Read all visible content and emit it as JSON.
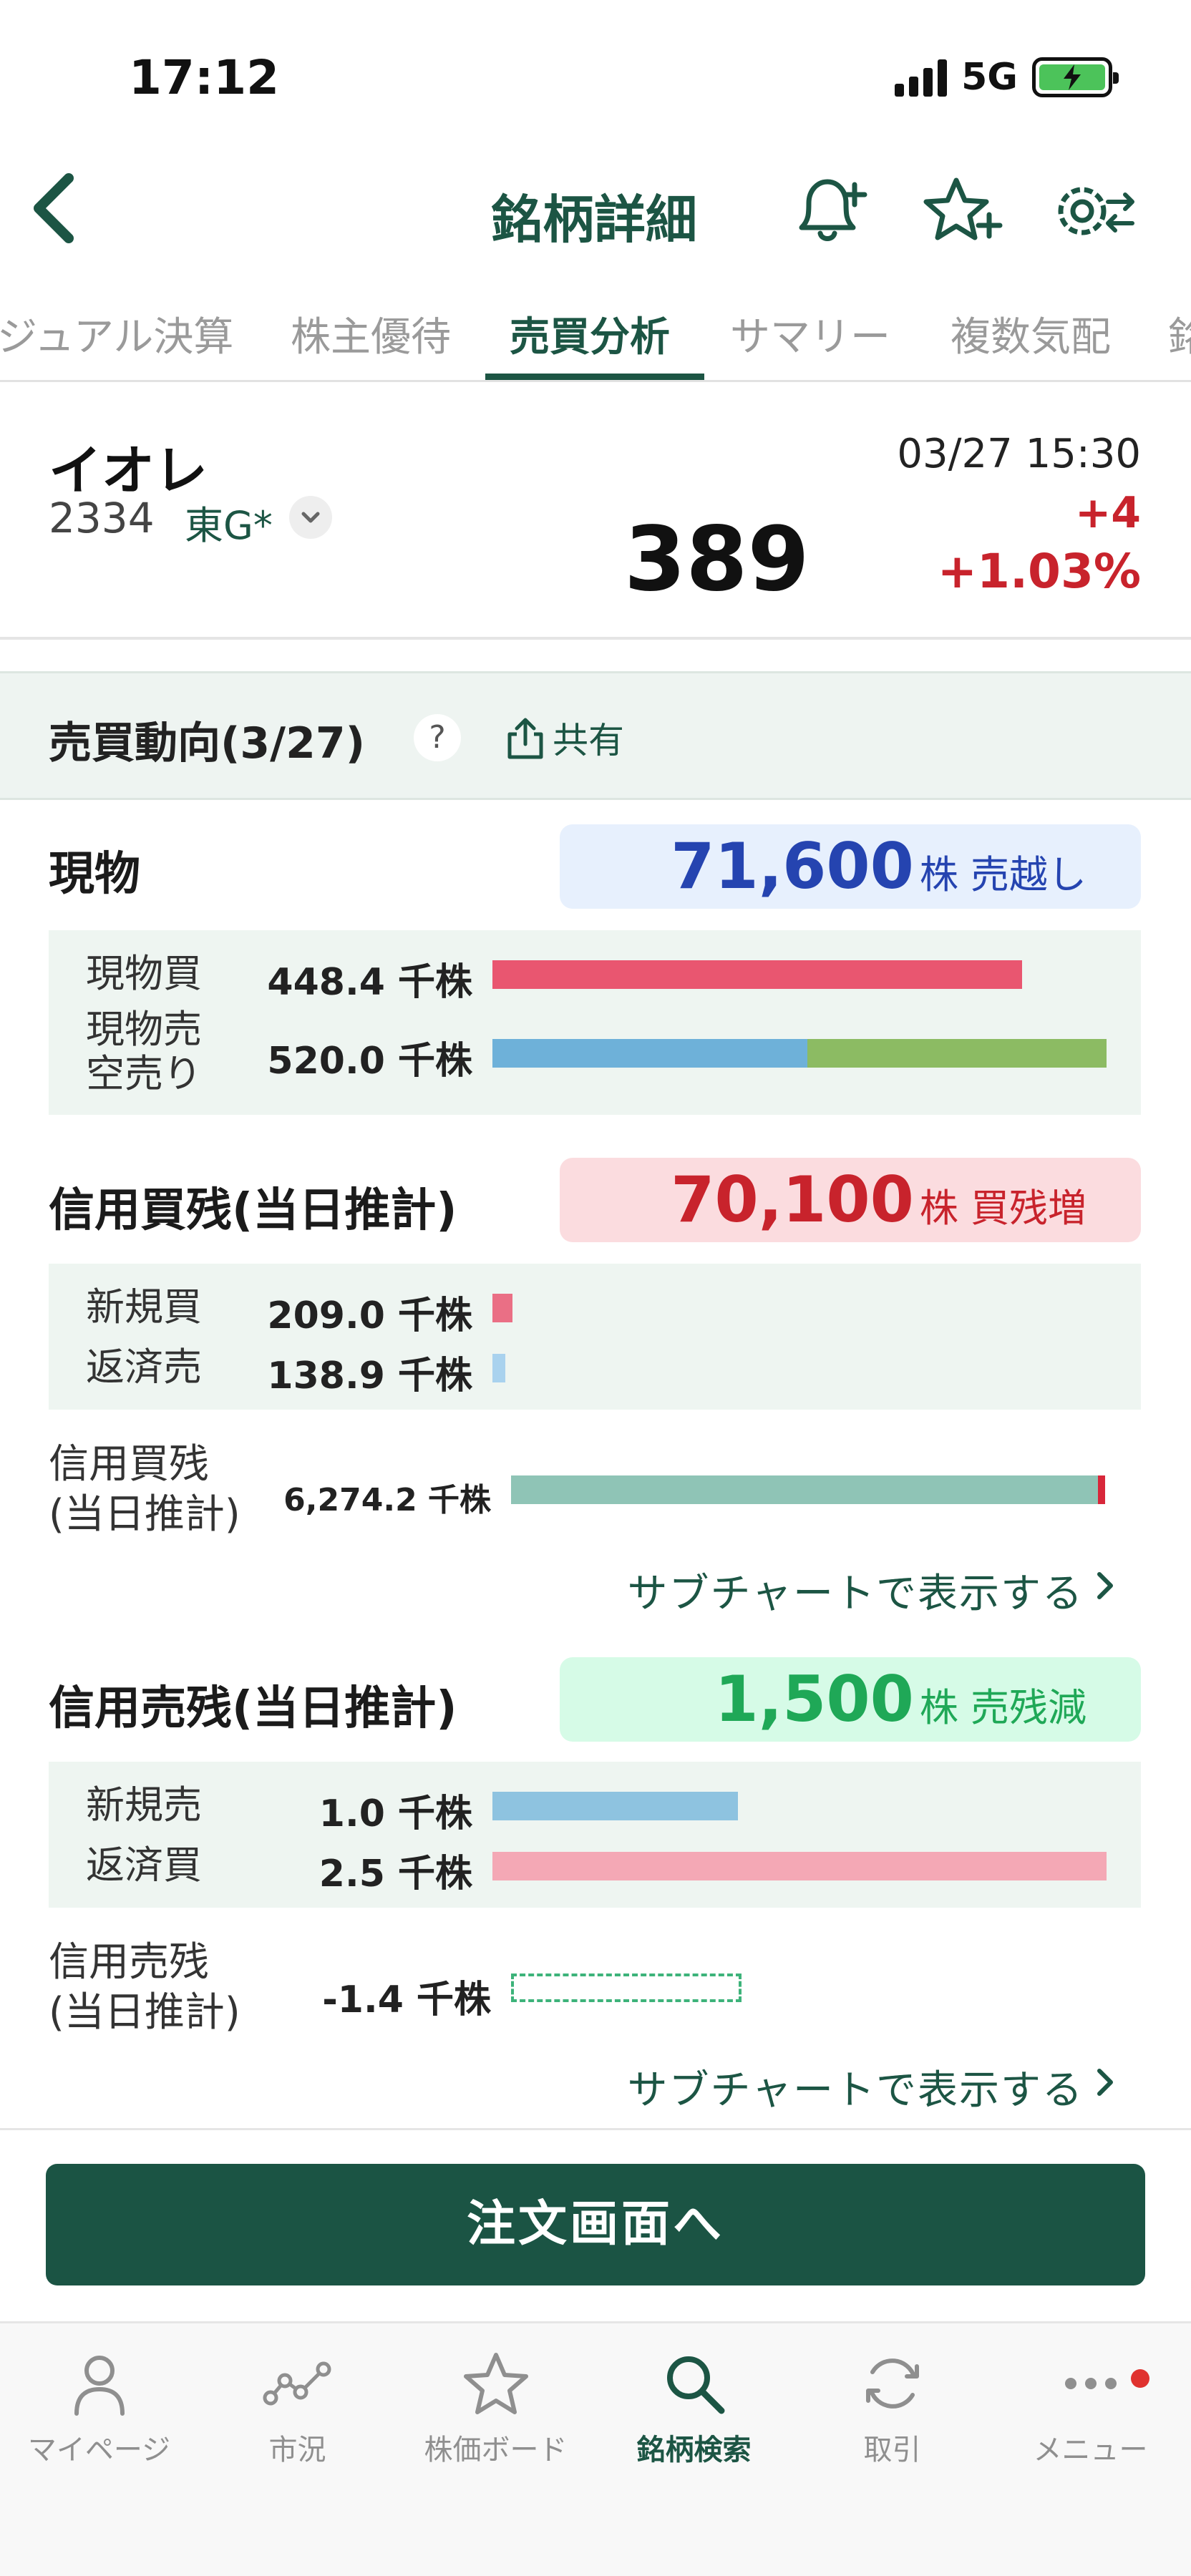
{
  "status_bar": {
    "time": "17:12",
    "network": "5G"
  },
  "header": {
    "title": "銘柄詳細"
  },
  "tabs": [
    {
      "label": "ジュアル決算"
    },
    {
      "label": "株主優待"
    },
    {
      "label": "売買分析"
    },
    {
      "label": "サマリー"
    },
    {
      "label": "複数気配"
    },
    {
      "label": "銘"
    }
  ],
  "active_tab": "売買分析",
  "stock": {
    "name": "イオレ",
    "code": "2334",
    "market": "東G*",
    "datetime": "03/27 15:30",
    "price": "389",
    "change": "+4",
    "change_pct": "+1.03%"
  },
  "section": {
    "title": "売買動向(3/27)",
    "help": "?",
    "share": "共有"
  },
  "spot": {
    "title": "現物",
    "badge_value": "71,600",
    "badge_unit": "株 売越し",
    "rows": [
      {
        "label": "現物買",
        "value": "448.4 千株",
        "bar_fraction": 0.862
      },
      {
        "label1": "現物売",
        "label2": "空売り",
        "value": "520.0 千株",
        "bar_fraction": 1.0,
        "split_fraction": 0.513
      }
    ]
  },
  "margin_buy": {
    "title": "信用買残(当日推計)",
    "badge_value": "70,100",
    "badge_unit": "株 買残増",
    "rows": [
      {
        "label": "新規買",
        "value": "209.0 千株"
      },
      {
        "label": "返済売",
        "value": "138.9 千株"
      }
    ],
    "balance_label1": "信用買残",
    "balance_label2": "(当日推計)",
    "balance_value": "6,274.2 千株",
    "subchart": "サブチャートで表示する"
  },
  "margin_sell": {
    "title": "信用売残(当日推計)",
    "badge_value": "1,500",
    "badge_unit": "株 売残減",
    "rows": [
      {
        "label": "新規売",
        "value": "1.0 千株",
        "bar_fraction": 0.4
      },
      {
        "label": "返済買",
        "value": "2.5 千株",
        "bar_fraction": 1.0
      }
    ],
    "balance_label1": "信用売残",
    "balance_label2": "(当日推計)",
    "balance_value": "-1.4 千株",
    "subchart": "サブチャートで表示する"
  },
  "order_button": "注文画面へ",
  "bottom_nav": [
    {
      "label": "マイページ",
      "icon": "person-icon"
    },
    {
      "label": "市況",
      "icon": "market-chart-icon"
    },
    {
      "label": "株価ボード",
      "icon": "star-icon"
    },
    {
      "label": "銘柄検索",
      "icon": "search-icon"
    },
    {
      "label": "取引",
      "icon": "refresh-icon"
    },
    {
      "label": "メニュー",
      "icon": "more-icon"
    }
  ],
  "active_nav": "銘柄検索",
  "colors": {
    "brand_green": "#1c5544",
    "up_red": "#c8232c",
    "spot_badge_bg": "#e7f0fd",
    "spot_badge_text": "#2544b0",
    "buy_badge_bg": "#fbdcdf",
    "buy_badge_text": "#c8232c",
    "sell_badge_bg": "#d6fbe7",
    "sell_badge_text": "#1fa857"
  }
}
